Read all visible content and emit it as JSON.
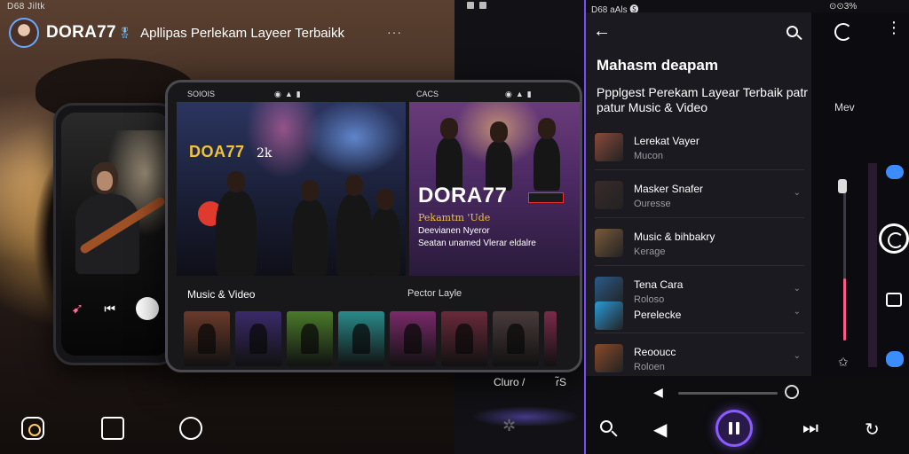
{
  "promo": {
    "status_time": "D68 Jiltk",
    "brand": {
      "name": "DORA77",
      "badge": "🎖",
      "tagline": "Apllipas Perlekam Layeer Terbaikk",
      "more": "···"
    },
    "concert": {
      "title": "DOA77",
      "subtitle": "2k"
    },
    "purple": {
      "title": "DORA77",
      "line1": "Pekamtm 'Ude",
      "line2": "Deevianen Nyeror",
      "line3": "Seatan unamed Vlerar eldalre"
    },
    "center_status_a": "SOIOIS",
    "center_status_b": "CACS",
    "section_a": "Music & Video",
    "section_b": "Pector Layle",
    "thumb_colors": [
      "#6a3a2a",
      "#3a2a6a",
      "#4a7a2a",
      "#2a8a8a",
      "#7a2a6a",
      "#6a2a3a",
      "#4a3a3a",
      "#7a2a4a"
    ],
    "cut_text_a": "Cluro /",
    "cut_text_b": "ɾ̃S"
  },
  "app": {
    "status_left": "D68 aAls 🅢",
    "status_right": "⊙⊙3%",
    "title": "Mahasm deapam",
    "subtitle": "Ppplgest Perekam Layear Terbaik patr patur Music & Video",
    "items": [
      {
        "title": "Lerekat Vayer",
        "sub": "Mucon",
        "color": "#8a4a3a"
      },
      {
        "title": "Masker Snafer",
        "sub": "Ouresse",
        "color": "#3a2a2a"
      },
      {
        "title": "Music & bihbakry",
        "sub": "Kerage",
        "color": "#7a5a3a"
      },
      {
        "title": "Tena Cara",
        "sub": "Roloso",
        "color": "#2a5a8a"
      },
      {
        "title": "Perelecke",
        "sub": "",
        "color": "#2a9ad8"
      },
      {
        "title": "Reooucc",
        "sub": "Roloen",
        "color": "#8a4a2a"
      }
    ],
    "side_label": "Mev"
  },
  "colors": {
    "accent": "#8a5cff",
    "highlight": "#ff5a8a",
    "gold": "#f2c23a"
  }
}
